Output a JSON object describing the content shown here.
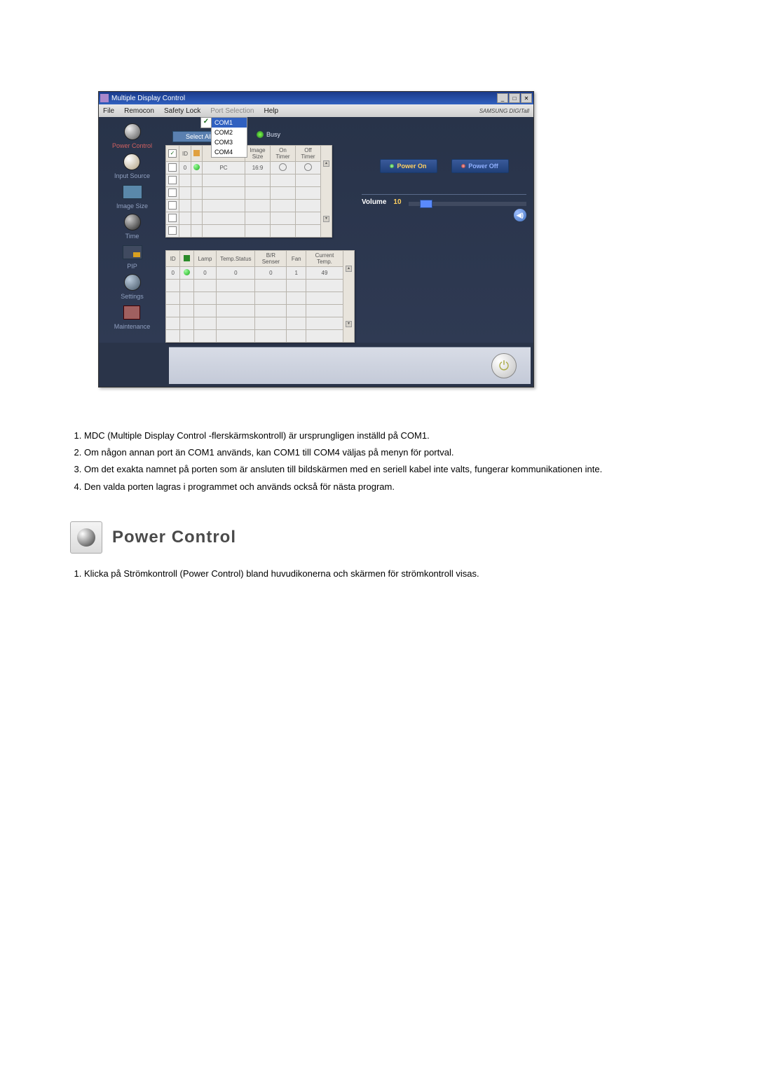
{
  "app": {
    "title": "Multiple Display Control",
    "brand": "SAMSUNG DIGITall"
  },
  "menu": {
    "file": "File",
    "remocon": "Remocon",
    "safety": "Safety Lock",
    "port": "Port Selection",
    "help": "Help"
  },
  "ports": {
    "com1": "COM1",
    "com2": "COM2",
    "com3": "COM3",
    "com4": "COM4"
  },
  "sidebar": {
    "power": "Power Control",
    "input": "Input Source",
    "image": "Image Size",
    "time": "Time",
    "pip": "PIP",
    "settings": "Settings",
    "maint": "Maintenance"
  },
  "center": {
    "select_all": "Select All",
    "busy": "Busy",
    "grid1": {
      "hdr_id": "ID",
      "hdr_src": "- . -",
      "hdr_isz": "Image Size",
      "hdr_ont": "On Timer",
      "hdr_oft": "Off Timer",
      "row1": {
        "id": "0",
        "src": "PC",
        "isz": "16:9"
      }
    },
    "grid2": {
      "hdr_id": "ID",
      "hdr_lamp": "Lamp",
      "hdr_ts": "Temp.Status",
      "hdr_bs": "B/R Senser",
      "hdr_fan": "Fan",
      "hdr_ct": "Current Temp.",
      "row1": {
        "id": "0",
        "lamp": "0",
        "ts": "0",
        "bs": "0",
        "fan": "1",
        "ct": "49"
      }
    }
  },
  "right": {
    "power_on": "Power On",
    "power_off": "Power Off",
    "volume": "Volume",
    "vol_val": "10"
  },
  "body": {
    "li1": "MDC (Multiple Display Control -flerskärmskontroll) är ursprungligen inställd på COM1.",
    "li2": "Om någon annan port än COM1 används, kan COM1 till COM4 väljas på menyn för portval.",
    "li3": "Om det exakta namnet på porten som är ansluten till bildskärmen med en seriell kabel inte valts, fungerar kommunikationen inte.",
    "li4": "Den valda porten lagras i programmet och används också för nästa program."
  },
  "section": {
    "title": "Power Control",
    "li1": "Klicka på Strömkontroll (Power Control) bland huvudikonerna och skärmen för strömkontroll visas."
  }
}
